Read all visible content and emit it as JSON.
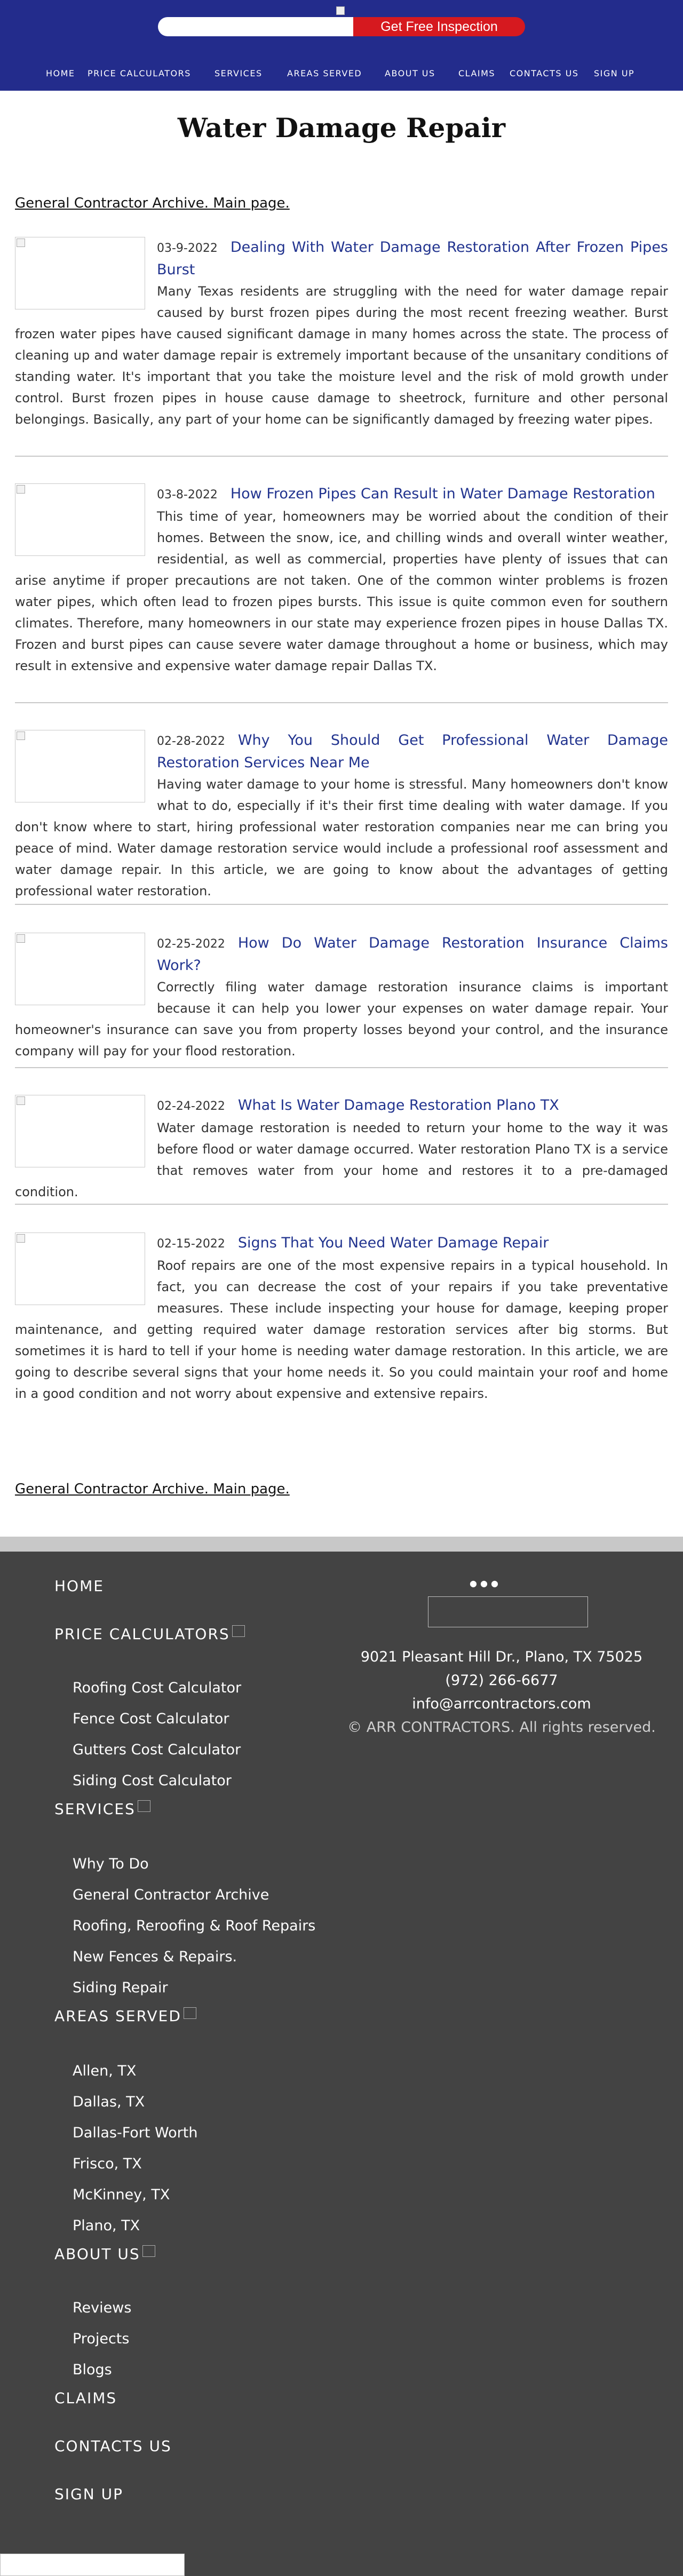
{
  "header": {
    "cta_label": "Get Free Inspection",
    "search_placeholder": "",
    "nav": [
      {
        "label": "HOME"
      },
      {
        "label": "PRICE CALCULATORS"
      },
      {
        "label": "SERVICES"
      },
      {
        "label": "AREAS SERVED"
      },
      {
        "label": "ABOUT US"
      },
      {
        "label": "CLAIMS"
      },
      {
        "label": "CONTACTS US"
      },
      {
        "label": "SIGN UP"
      }
    ],
    "colors": {
      "nav_bg": "#232c8c",
      "cta_bg": "#d6191f"
    }
  },
  "main": {
    "page_title": "Water Damage Repair",
    "archive_link_top": "General Contractor Archive. Main page.",
    "archive_link_bottom": "General Contractor Archive. Main page.",
    "articles": [
      {
        "date": "03-9-2022",
        "title": "Dealing With Water Damage Restoration After Frozen Pipes Burst",
        "body": "Many Texas residents are struggling with the need for water damage repair caused by burst frozen pipes during the most recent freezing weather. Burst frozen water pipes have caused significant damage in many homes across the state. The process of cleaning up and water damage repair is extremely important because of the unsanitary conditions of standing water. It's important that you take the moisture level and the risk of mold growth under control. Burst frozen pipes in house cause damage to sheetrock, furniture and other personal belongings. Basically, any part of your home can be significantly damaged by freezing water pipes."
      },
      {
        "date": "03-8-2022",
        "title": "How Frozen Pipes Can Result in Water Damage Restoration",
        "body": "This time of year, homeowners may be worried about the condition of their homes. Between the snow, ice, and chilling winds and overall winter weather, residential, as well as commercial, properties have plenty of issues that can arise anytime if proper precautions are not taken. One of the common winter problems is frozen water pipes, which often lead to frozen pipes bursts. This issue is quite common even for southern climates. Therefore, many homeowners in our state may experience frozen pipes in house Dallas TX. Frozen and burst pipes can cause severe water damage throughout a home or business, which may result in extensive and expensive water damage repair Dallas TX."
      },
      {
        "date": "02-28-2022",
        "title": "Why You Should Get Professional Water Damage Restoration Services Near Me",
        "body": "Having water damage to your home is stressful. Many homeowners don't know what to do, especially if it's their first time dealing with water damage. If you don't know where to start, hiring professional water restoration companies near me can bring you peace of mind. Water damage restoration service would include a professional roof assessment and water damage repair. In this article, we are going to know about the advantages of getting professional water restoration."
      },
      {
        "date": "02-25-2022",
        "title": "How Do Water Damage Restoration Insurance Claims Work?",
        "body": "Correctly filing water damage restoration insurance claims is important because it can help you lower your expenses on water damage repair. Your homeowner's insurance can save you from property losses beyond your control, and the insurance company will pay for your flood restoration."
      },
      {
        "date": "02-24-2022",
        "title": "What Is Water Damage Restoration Plano TX",
        "body": "Water damage restoration is needed to return your home to the way it was before flood or water damage occurred. Water restoration Plano TX is a service that removes water from your home and restores it to a pre-damaged condition."
      },
      {
        "date": "02-15-2022",
        "title": "Signs That You Need Water Damage Repair",
        "body": "Roof repairs are one of the most expensive repairs in a typical household. In fact, you can decrease the cost of your repairs if you take preventative measures. These include inspecting your house for damage, keeping proper maintenance, and getting required water damage restoration services after big storms. But sometimes it is hard to tell if your home is needing water damage restoration. In this article, we are going to describe several signs that your home needs it. So you could maintain your roof and home in a good condition and not worry about expensive and extensive repairs."
      }
    ]
  },
  "footer": {
    "home": "HOME",
    "price_calculators": {
      "label": "PRICE CALCULATORS",
      "items": [
        "Roofing Cost Calculator",
        "Fence Cost Calculator",
        "Gutters Cost Calculator",
        "Siding Cost Calculator"
      ]
    },
    "services": {
      "label": "SERVICES",
      "items": [
        "Why To Do",
        "General Contractor Archive",
        "Roofing, Reroofing & Roof Repairs",
        "New Fences & Repairs.",
        "Siding Repair"
      ]
    },
    "areas_served": {
      "label": "AREAS SERVED",
      "items": [
        "Allen, TX",
        "Dallas, TX",
        "Dallas-Fort Worth",
        "Frisco, TX",
        "McKinney, TX",
        "Plano, TX"
      ]
    },
    "about_us": {
      "label": "ABOUT US",
      "items": [
        "Reviews",
        "Projects",
        "Blogs"
      ]
    },
    "claims": "CLAIMS",
    "contacts_us": "CONTACTS US",
    "sign_up": "SIGN UP",
    "address": "9021 Pleasant Hill Dr., Plano, TX 75025",
    "phone": "(972) 266-6677",
    "email": "info@arrcontractors.com",
    "copyright": "© ARR CONTRACTORS. All rights reserved.",
    "colors": {
      "footer_bg": "#434343"
    }
  }
}
